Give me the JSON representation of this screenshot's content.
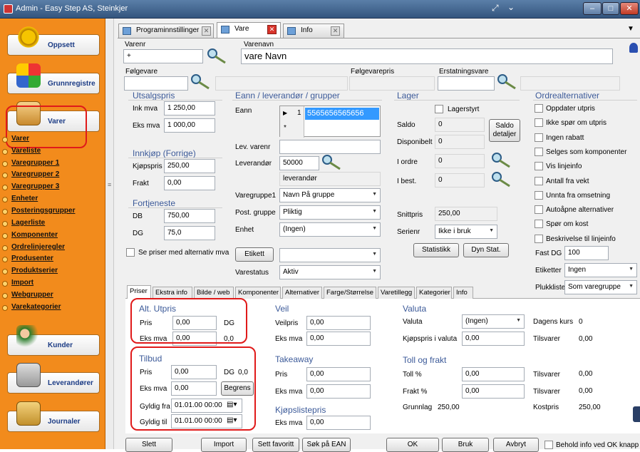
{
  "window": {
    "title": "Admin - Easy Step AS, Steinkjer"
  },
  "sidebar": {
    "buttons": [
      {
        "label": "Oppsett"
      },
      {
        "label": "Grunnregistre"
      },
      {
        "label": "Varer"
      },
      {
        "label": "Kunder"
      },
      {
        "label": "Leverandører"
      },
      {
        "label": "Journaler"
      }
    ],
    "subitems": [
      "Varer",
      "Vareliste",
      "Varegrupper 1",
      "Varegrupper 2",
      "Varegrupper 3",
      "Enheter",
      "Posteringsgrupper",
      "Lagerliste",
      "Komponenter",
      "Ordrelinjeregler",
      "Produsenter",
      "Produktserier",
      "Import",
      "Webgrupper",
      "Varekategorier"
    ]
  },
  "tabs": [
    {
      "label": "Programinnstillinger"
    },
    {
      "label": "Vare"
    },
    {
      "label": "Info"
    }
  ],
  "header": {
    "varenr_label": "Varenr",
    "varenr": "+",
    "varenavn_label": "Varenavn",
    "varenavn": "vare Navn",
    "folgevare_label": "Følgevare",
    "folgevarepris_label": "Følgevarepris",
    "erstatningsvare_label": "Erstatningsvare"
  },
  "utsalgspris": {
    "title": "Utsalgspris",
    "ink_label": "Ink mva",
    "ink": "1 250,00",
    "eks_label": "Eks mva",
    "eks": "1 000,00"
  },
  "innkjop": {
    "title": "Innkjøp (Forrige)",
    "kjopspris_label": "Kjøpspris",
    "kjopspris": "250,00",
    "frakt_label": "Frakt",
    "frakt": "0,00"
  },
  "fortjeneste": {
    "title": "Fortjeneste",
    "db_label": "DB",
    "db": "750,00",
    "dg_label": "DG",
    "dg": "75,0"
  },
  "se_priser": "Se priser med alternativ mva",
  "eann": {
    "title": "Eann / leverandør / grupper",
    "eann_label": "Eann",
    "grid_rownum": "1",
    "grid_value": "5565656565656",
    "grid_new": "*",
    "levvarenr_label": "Lev. varenr",
    "leverandor_label": "Leverandør",
    "leverandor_nr": "50000",
    "leverandor_navn": "leverandør",
    "vg1_label": "Varegruppe1",
    "vg1": "Navn På gruppe",
    "postgr_label": "Post. gruppe",
    "postgr": "Pliktig",
    "enhet_label": "Enhet",
    "enhet": "(Ingen)",
    "etikett_btn": "Etikett",
    "varestatus_label": "Varestatus",
    "varestatus": "Aktiv"
  },
  "lager": {
    "title": "Lager",
    "lagerstyrt": "Lagerstyrt",
    "saldo_label": "Saldo",
    "saldo": "0",
    "disp_label": "Disponibelt",
    "disp": "0",
    "saldo_btn": "Saldo detaljer",
    "iordre_label": "I ordre",
    "iordre": "0",
    "ibest_label": "I best.",
    "ibest": "0",
    "snittpris_label": "Snittpris",
    "snittpris": "250,00",
    "serienr_label": "Serienr",
    "serienr": "Ikke i bruk",
    "statistikk_btn": "Statistikk",
    "dynstat_btn": "Dyn Stat."
  },
  "ordre": {
    "title": "Ordrealternativer",
    "options": [
      "Oppdater utpris",
      "Ikke spør om utpris",
      "Ingen rabatt",
      "Selges som komponenter",
      "Vis linjeinfo",
      "Antall fra vekt",
      "Unnta fra omsetning",
      "Autoåpne alternativer",
      "Spør om kost",
      "Beskrivelse til linjeinfo"
    ],
    "fastdg_label": "Fast DG",
    "fastdg": "100",
    "etiketter_label": "Etiketter",
    "etiketter": "Ingen",
    "plukkliste_label": "Plukkliste",
    "plukkliste": "Som varegruppe"
  },
  "bottom_tabs": [
    "Priser",
    "Ekstra info",
    "Bilde / web",
    "Komponenter",
    "Alternativer",
    "Farge/Størrelse",
    "Varetillegg",
    "Kategorier",
    "Info"
  ],
  "alt_utpris": {
    "title": "Alt. Utpris",
    "pris_label": "Pris",
    "pris": "0,00",
    "dg_label": "DG",
    "eks_label": "Eks mva",
    "eks": "0,00",
    "dg": "0,0"
  },
  "tilbud": {
    "title": "Tilbud",
    "pris_label": "Pris",
    "pris": "0,00",
    "dg_label": "DG",
    "dg": "0,0",
    "eks_label": "Eks mva",
    "eks": "0,00",
    "begrens_btn": "Begrens",
    "fra_label": "Gyldig fra",
    "fra": "01.01.00 00:00",
    "til_label": "Gyldig til",
    "til": "01.01.00 00:00"
  },
  "veil": {
    "title": "Veil",
    "veil_label": "Veilpris",
    "veil": "0,00",
    "eks_label": "Eks mva",
    "eks": "0,00"
  },
  "takeaway": {
    "title": "Takeaway",
    "pris_label": "Pris",
    "pris": "0,00",
    "eks_label": "Eks mva",
    "eks": "0,00"
  },
  "kjopsliste": {
    "title": "Kjøpslistepris",
    "eks_label": "Eks mva",
    "eks": "0,00"
  },
  "valuta": {
    "title": "Valuta",
    "valuta_label": "Valuta",
    "valuta": "(Ingen)",
    "kurs_label": "Dagens kurs",
    "kurs": "0",
    "kjops_label": "Kjøpspris i valuta",
    "kjops": "0,00",
    "tilsvarer_label": "Tilsvarer",
    "tilsvarer": "0,00"
  },
  "toll": {
    "title": "Toll og frakt",
    "toll_label": "Toll %",
    "toll": "0,00",
    "toll_tils_label": "Tilsvarer",
    "toll_tils": "0,00",
    "frakt_label": "Frakt %",
    "frakt": "0,00",
    "frakt_tils_label": "Tilsvarer",
    "frakt_tils": "0,00",
    "grunnlag_label": "Grunnlag",
    "grunnlag": "250,00",
    "kostpris_label": "Kostpris",
    "kostpris": "250,00"
  },
  "footer": {
    "slett": "Slett",
    "import": "Import",
    "sett_favoritt": "Sett favoritt",
    "sok_ean": "Søk på EAN",
    "ok": "OK",
    "bruk": "Bruk",
    "avbryt": "Avbryt",
    "behold": "Behold info ved OK knapp"
  }
}
